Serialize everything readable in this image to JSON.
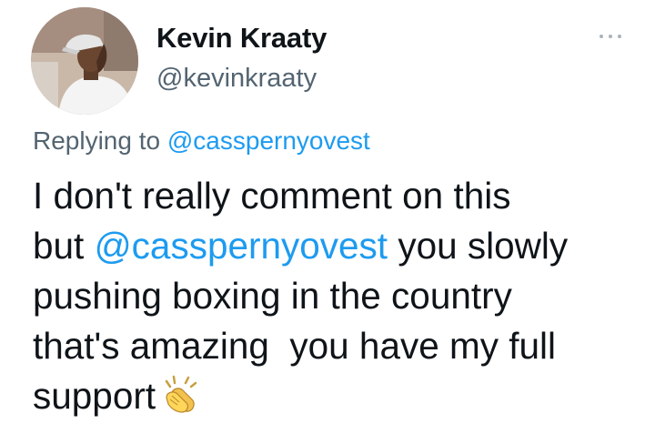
{
  "user": {
    "display_name": "Kevin Kraaty",
    "handle": "@kevinkraaty",
    "avatar_icon": "profile-photo"
  },
  "more_icon": "more-horizontal-icon",
  "reply": {
    "prefix": "Replying to",
    "mention": "@casspernyovest"
  },
  "tweet": {
    "line1": "I don't really  comment  on this",
    "line2_before": "but ",
    "line2_mention": "@casspernyovest",
    "line2_after": " you slowly",
    "line3": "pushing boxing in the country",
    "line4": "that's amazing  you have my full",
    "line5": "support",
    "emoji": "clapping-hands-icon"
  },
  "colors": {
    "link": "#1d9bf0",
    "secondary_text": "#536471",
    "primary_text": "#0f1419"
  }
}
